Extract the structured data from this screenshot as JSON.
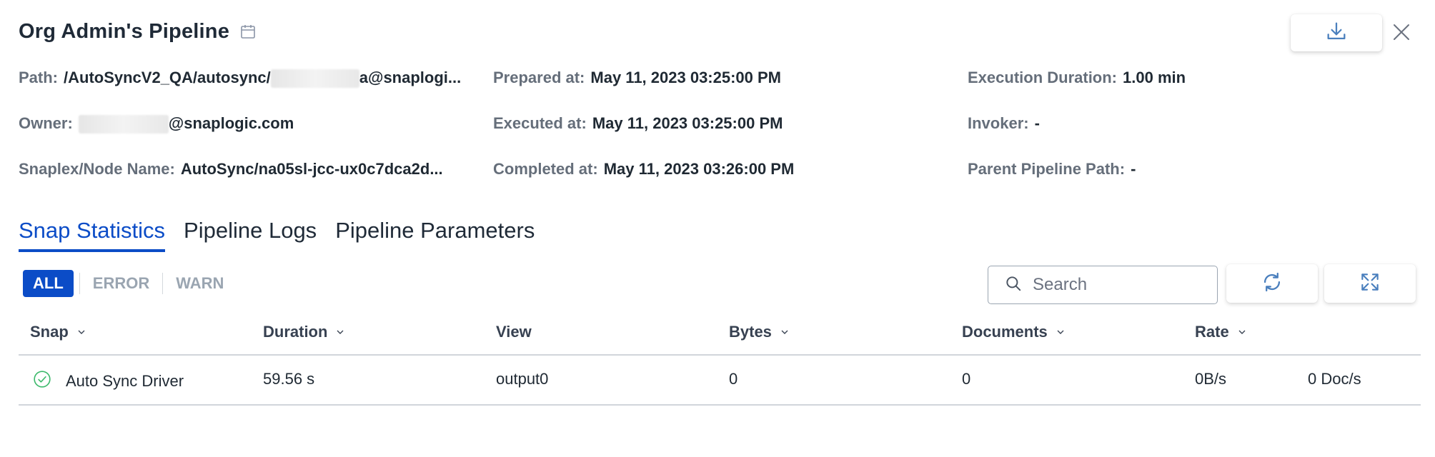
{
  "header": {
    "title": "Org Admin's Pipeline",
    "calendar_icon": "calendar-icon",
    "download_icon": "download-icon",
    "close_icon": "close-icon"
  },
  "meta": {
    "path_label": "Path:",
    "path_value_start": "/AutoSyncV2_QA/autosync/",
    "path_value_end": "a@snaplogi...",
    "owner_label": "Owner:",
    "owner_value": "@snaplogic.com",
    "snaplex_label": "Snaplex/Node Name:",
    "snaplex_value": "AutoSync/na05sl-jcc-ux0c7dca2d...",
    "prepared_label": "Prepared at:",
    "prepared_value": "May 11, 2023 03:25:00 PM",
    "executed_label": "Executed at:",
    "executed_value": "May 11, 2023 03:25:00 PM",
    "completed_label": "Completed at:",
    "completed_value": "May 11, 2023 03:26:00 PM",
    "duration_label": "Execution Duration:",
    "duration_value": "1.00 min",
    "invoker_label": "Invoker:",
    "invoker_value": "-",
    "parent_label": "Parent Pipeline Path:",
    "parent_value": "-"
  },
  "tabs": [
    {
      "label": "Snap Statistics",
      "active": true
    },
    {
      "label": "Pipeline Logs",
      "active": false
    },
    {
      "label": "Pipeline Parameters",
      "active": false
    }
  ],
  "filters": {
    "all": "ALL",
    "error": "ERROR",
    "warn": "WARN"
  },
  "search": {
    "placeholder": "Search",
    "icon": "search-icon"
  },
  "toolbar": {
    "refresh_icon": "refresh-icon",
    "expand_icon": "expand-icon"
  },
  "table": {
    "headers": {
      "snap": "Snap",
      "duration": "Duration",
      "view": "View",
      "bytes": "Bytes",
      "documents": "Documents",
      "rate": "Rate"
    },
    "rows": [
      {
        "status_icon": "check-circle-icon",
        "snap": "Auto Sync Driver",
        "duration": "59.56 s",
        "view": "output0",
        "bytes": "0",
        "documents": "0",
        "rate_bytes": "0B/s",
        "rate_docs": "0 Doc/s"
      }
    ]
  },
  "colors": {
    "accent": "#0b4cc7",
    "success": "#3cb96b",
    "icon": "#4a7fbd"
  }
}
